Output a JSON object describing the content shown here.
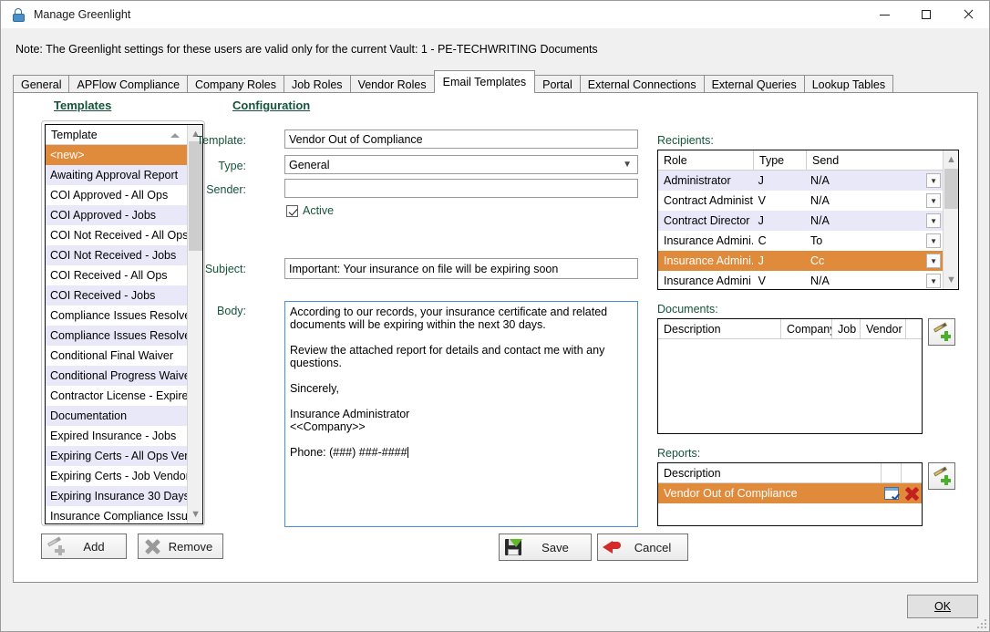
{
  "window": {
    "title": "Manage Greenlight",
    "icon": "lock-icon",
    "minimize": "—",
    "maximize": "□",
    "close": "✕"
  },
  "note": "Note:  The Greenlight settings for these users are valid only for the current Vault: 1 - PE-TECHWRITING Documents",
  "tabs": [
    {
      "label": "General",
      "active": false
    },
    {
      "label": "APFlow Compliance",
      "active": false
    },
    {
      "label": "Company Roles",
      "active": false
    },
    {
      "label": "Job Roles",
      "active": false
    },
    {
      "label": "Vendor Roles",
      "active": false
    },
    {
      "label": "Email Templates",
      "active": true
    },
    {
      "label": "Portal",
      "active": false
    },
    {
      "label": "External Connections",
      "active": false
    },
    {
      "label": "External Queries",
      "active": false
    },
    {
      "label": "Lookup Tables",
      "active": false
    }
  ],
  "templates_panel": {
    "heading": "Templates",
    "column_header": "Template",
    "items": [
      "<new>",
      "Awaiting Approval Report",
      "COI Approved - All Ops",
      "COI Approved - Jobs",
      "COI Not Received - All Ops",
      "COI Not Received - Jobs",
      "COI Received - All Ops",
      "COI Received - Jobs",
      "Compliance Issues Resolved - ...",
      "Compliance Issues Resolved - J...",
      "Conditional Final Waiver",
      "Conditional Progress Waiver",
      "Contractor License - Expired",
      "Documentation",
      "Expired Insurance - Jobs",
      "Expiring Certs - All Ops Vendor",
      "Expiring Certs - Job Vendors Only",
      "Expiring Insurance 30 Days",
      "Insurance Compliance Issues - ..."
    ],
    "selected_index": 0,
    "add_label": "Add",
    "remove_label": "Remove"
  },
  "configuration": {
    "heading": "Configuration",
    "fields": {
      "template_label": "Template:",
      "template_value": "Vendor Out of Compliance",
      "type_label": "Type:",
      "type_value": "General",
      "sender_label": "Sender:",
      "sender_value": "",
      "active_label": "Active",
      "active_checked": true,
      "subject_label": "Subject:",
      "subject_value": "Important: Your insurance on file will be expiring soon",
      "body_label": "Body:",
      "body_value": "According to our records, your insurance certificate and related documents will be expiring within the next 30 days.\n\nReview the attached report for details and contact me with any questions.\n\nSincerely,\n\nInsurance Administrator\n<<Company>>\n\nPhone: (###) ###-####"
    },
    "save_label": "Save",
    "cancel_label": "Cancel"
  },
  "recipients": {
    "label": "Recipients:",
    "columns": [
      "Role",
      "Type",
      "Send"
    ],
    "rows": [
      {
        "role": "Administrator",
        "type": "J",
        "send": "N/A"
      },
      {
        "role": "Contract Administ...",
        "type": "V",
        "send": "N/A"
      },
      {
        "role": "Contract Director",
        "type": "J",
        "send": "N/A"
      },
      {
        "role": "Insurance Admini...",
        "type": "C",
        "send": "To"
      },
      {
        "role": "Insurance Admini...",
        "type": "J",
        "send": "Cc"
      },
      {
        "role": "Insurance Admini",
        "type": "V",
        "send": "N/A"
      }
    ],
    "selected_index": 4
  },
  "documents": {
    "label": "Documents:",
    "columns": [
      "Description",
      "Company",
      "Job",
      "Vendor"
    ],
    "rows": [],
    "add_icon": "pen-plus-icon"
  },
  "reports": {
    "label": "Reports:",
    "columns": [
      "Description"
    ],
    "rows": [
      {
        "description": "Vendor Out of Compliance",
        "edit_icon": "edit-icon",
        "delete_icon": "delete-icon"
      }
    ],
    "selected_index": 0,
    "add_icon": "pen-plus-icon"
  },
  "footer": {
    "ok_label": "OK"
  },
  "colors": {
    "selection_orange": "#e08b3c",
    "alt_row": "#e8e8f8",
    "label_green": "#14543a",
    "focus_blue": "#4a90d9"
  }
}
